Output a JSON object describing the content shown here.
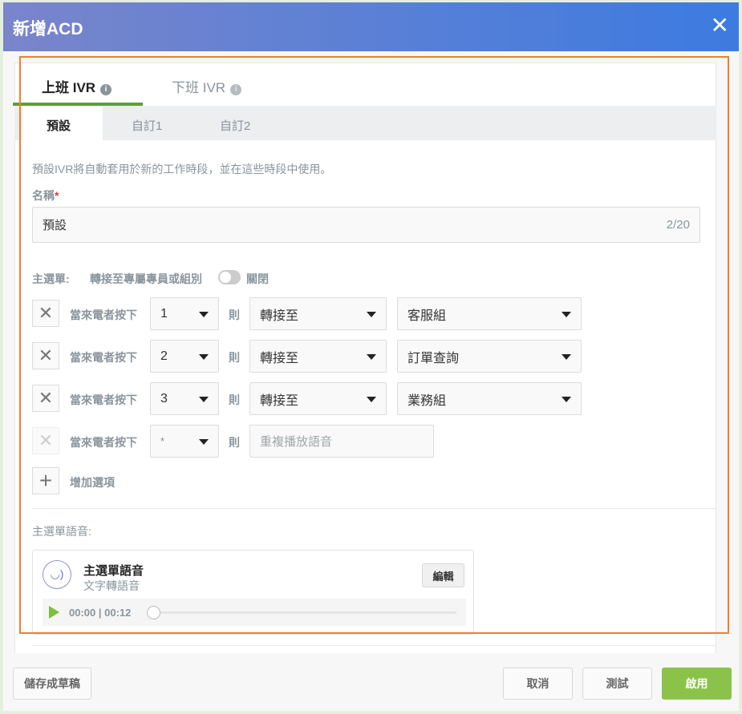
{
  "dialog": {
    "title": "新增ACD",
    "close_icon": "close-icon"
  },
  "tabs": [
    {
      "label": "上班 IVR",
      "active": true
    },
    {
      "label": "下班 IVR",
      "active": false
    }
  ],
  "sub_tabs": [
    {
      "label": "預設",
      "active": true
    },
    {
      "label": "自訂1"
    },
    {
      "label": "自訂2"
    }
  ],
  "description": "預設IVR將自動套用於新的工作時段，並在這些時段中使用。",
  "name_field": {
    "label": "名稱",
    "required_mark": "*",
    "value": "預設",
    "counter": "2/20"
  },
  "main_menu": {
    "label": "主選單:",
    "transfer_label": "轉接至專屬專員或組別",
    "toggle_state": "關閉",
    "toggle_on": false
  },
  "rows": [
    {
      "prefix": "當來電者按下",
      "key": "1",
      "then": "則",
      "action": "轉接至",
      "target": "客服組"
    },
    {
      "prefix": "當來電者按下",
      "key": "2",
      "then": "則",
      "action": "轉接至",
      "target": "訂單查詢"
    },
    {
      "prefix": "當來電者按下",
      "key": "3",
      "then": "則",
      "action": "轉接至",
      "target": "業務組"
    },
    {
      "prefix": "當來電者按下",
      "key": "*",
      "then": "則",
      "action_placeholder": "重複播放語音",
      "disabled": true
    }
  ],
  "add_option": "增加選項",
  "audio": {
    "section_label": "主選單語音:",
    "title": "主選單語音",
    "subtitle": "文字轉語音",
    "edit": "編輯",
    "time": "00:00 | 00:12",
    "progress": 0
  },
  "footer": {
    "save_draft": "儲存成草稿",
    "cancel": "取消",
    "test": "測試",
    "enable": "啟用"
  },
  "colors": {
    "accent_green": "#8bc34a",
    "tab_underline": "#5e9e34",
    "header_start": "#7a85cb",
    "header_end": "#3c7be0",
    "annotation": "#f07f2a"
  }
}
